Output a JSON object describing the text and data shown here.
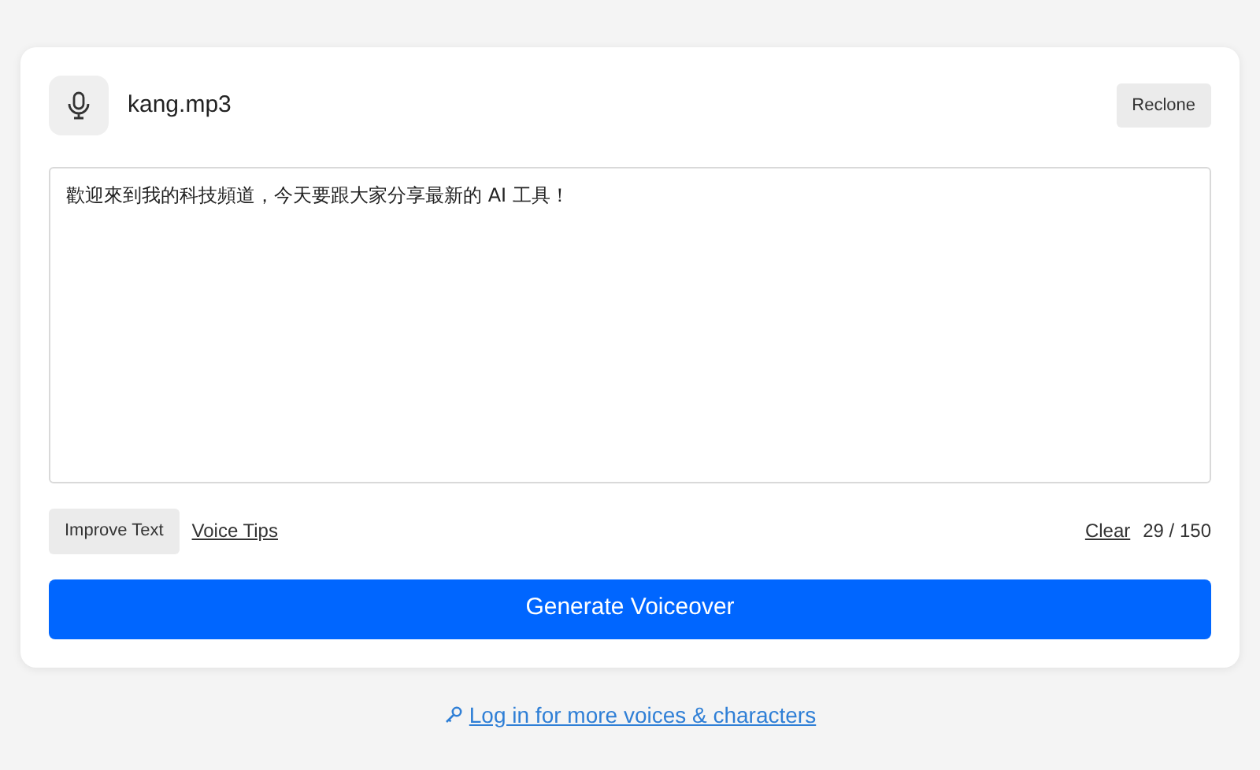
{
  "voice": {
    "file_name": "kang.mp3",
    "button": "Reclone"
  },
  "editor": {
    "value": "歡迎來到我的科技頻道，今天要跟大家分享最新的 AI 工具！"
  },
  "tools": {
    "improve": "Improve Text",
    "tips": "Voice Tips",
    "clear": "Clear",
    "count": "29 / 150"
  },
  "generate": "Generate Voiceover",
  "login_link": "Log in for more voices & characters"
}
